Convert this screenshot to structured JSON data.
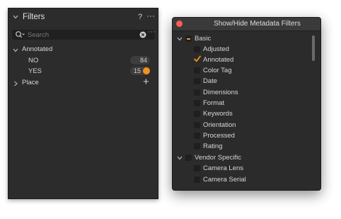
{
  "filters": {
    "title": "Filters",
    "help": "?",
    "more": "···",
    "search": {
      "placeholder": "Search",
      "value": "",
      "options": "···"
    },
    "groups": [
      {
        "label": "Annotated",
        "expanded": true,
        "items": [
          {
            "label": "NO",
            "count": "84",
            "selected": false
          },
          {
            "label": "YES",
            "count": "15",
            "selected": true
          }
        ]
      },
      {
        "label": "Place",
        "expanded": false,
        "add": "+"
      }
    ]
  },
  "metadata_window": {
    "title": "Show/Hide Metadata Filters",
    "groups": [
      {
        "label": "Basic",
        "expanded": true,
        "state": "mixed",
        "items": [
          {
            "label": "Adjusted",
            "checked": false
          },
          {
            "label": "Annotated",
            "checked": true
          },
          {
            "label": "Color Tag",
            "checked": false
          },
          {
            "label": "Date",
            "checked": false
          },
          {
            "label": "Dimensions",
            "checked": false
          },
          {
            "label": "Format",
            "checked": false
          },
          {
            "label": "Keywords",
            "checked": false
          },
          {
            "label": "Orientation",
            "checked": false
          },
          {
            "label": "Processed",
            "checked": false
          },
          {
            "label": "Rating",
            "checked": false
          }
        ]
      },
      {
        "label": "Vendor Specific",
        "expanded": true,
        "state": "unchecked",
        "items": [
          {
            "label": "Camera Lens",
            "checked": false
          },
          {
            "label": "Camera Serial",
            "checked": false
          }
        ]
      }
    ]
  },
  "colors": {
    "accent": "#f2921f",
    "panel": "#2c2c2c",
    "close": "#fc5d57"
  }
}
